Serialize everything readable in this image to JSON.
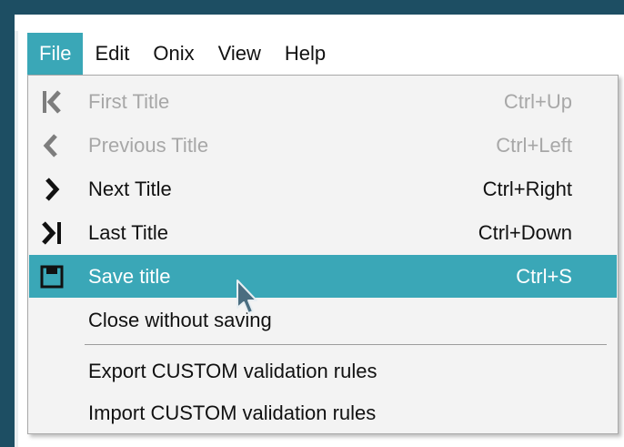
{
  "menubar": {
    "items": [
      {
        "label": "File"
      },
      {
        "label": "Edit"
      },
      {
        "label": "Onix"
      },
      {
        "label": "View"
      },
      {
        "label": "Help"
      }
    ]
  },
  "file_menu": {
    "items": [
      {
        "label": "First Title",
        "shortcut": "Ctrl+Up",
        "icon": "first-icon",
        "enabled": false
      },
      {
        "label": "Previous Title",
        "shortcut": "Ctrl+Left",
        "icon": "previous-icon",
        "enabled": false
      },
      {
        "label": "Next Title",
        "shortcut": "Ctrl+Right",
        "icon": "next-icon",
        "enabled": true
      },
      {
        "label": "Last Title",
        "shortcut": "Ctrl+Down",
        "icon": "last-icon",
        "enabled": true
      },
      {
        "label": "Save title",
        "shortcut": "Ctrl+S",
        "icon": "save-icon",
        "enabled": true,
        "highlighted": true
      },
      {
        "label": "Close without saving",
        "shortcut": "",
        "enabled": true
      },
      {
        "label": "Export CUSTOM validation rules",
        "shortcut": "",
        "enabled": true
      },
      {
        "label": "Import CUSTOM validation rules",
        "shortcut": "",
        "enabled": true
      }
    ]
  },
  "colors": {
    "accent": "#3aa7b7",
    "window_frame": "#1d4e63",
    "menu_background": "#f3f3f3",
    "disabled_text": "#a7a7a7"
  }
}
